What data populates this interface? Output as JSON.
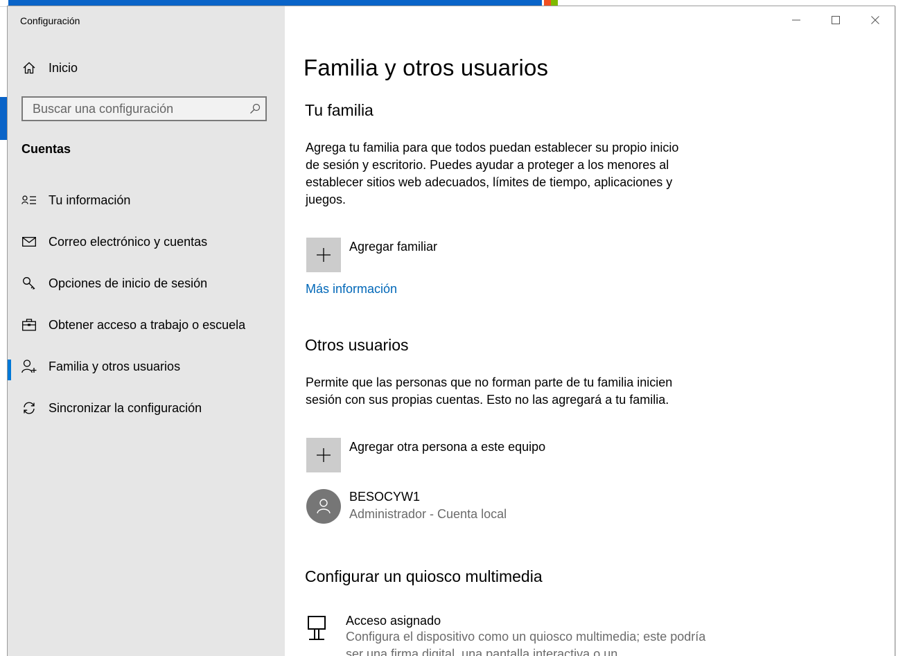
{
  "window": {
    "title": "Configuración"
  },
  "sidebar": {
    "home_label": "Inicio",
    "search_placeholder": "Buscar una configuración",
    "section": "Cuentas",
    "items": [
      {
        "label": "Tu información",
        "icon": "user-info-icon",
        "active": false
      },
      {
        "label": "Correo electrónico y cuentas",
        "icon": "mail-icon",
        "active": false
      },
      {
        "label": "Opciones de inicio de sesión",
        "icon": "key-icon",
        "active": false
      },
      {
        "label": "Obtener acceso a trabajo o escuela",
        "icon": "briefcase-icon",
        "active": false
      },
      {
        "label": "Familia y otros usuarios",
        "icon": "add-person-icon",
        "active": true
      },
      {
        "label": "Sincronizar la configuración",
        "icon": "sync-icon",
        "active": false
      }
    ]
  },
  "content": {
    "title": "Familia y otros usuarios",
    "family": {
      "heading": "Tu familia",
      "description": "Agrega tu familia para que todos puedan establecer su propio inicio de sesión y escritorio. Puedes ayudar a proteger a los menores al establecer sitios web adecuados, límites de tiempo, aplicaciones y juegos.",
      "add_label": "Agregar familiar",
      "more_info": "Más información"
    },
    "others": {
      "heading": "Otros usuarios",
      "description": "Permite que las personas que no forman parte de tu familia inicien sesión con sus propias cuentas. Esto no las agregará a tu familia.",
      "add_label": "Agregar otra persona a este equipo",
      "user_name": "BESOCYW1",
      "user_detail": "Administrador - Cuenta local"
    },
    "kiosk": {
      "heading": "Configurar un quiosco multimedia",
      "title": "Acceso asignado",
      "description": "Configura el dispositivo como un quiosco multimedia; este podría ser una firma digital, una pantalla interactiva o un"
    }
  },
  "colors": {
    "sidebar_bg": "#e6e6e6",
    "accent": "#0078d7",
    "link": "#0067b8"
  }
}
